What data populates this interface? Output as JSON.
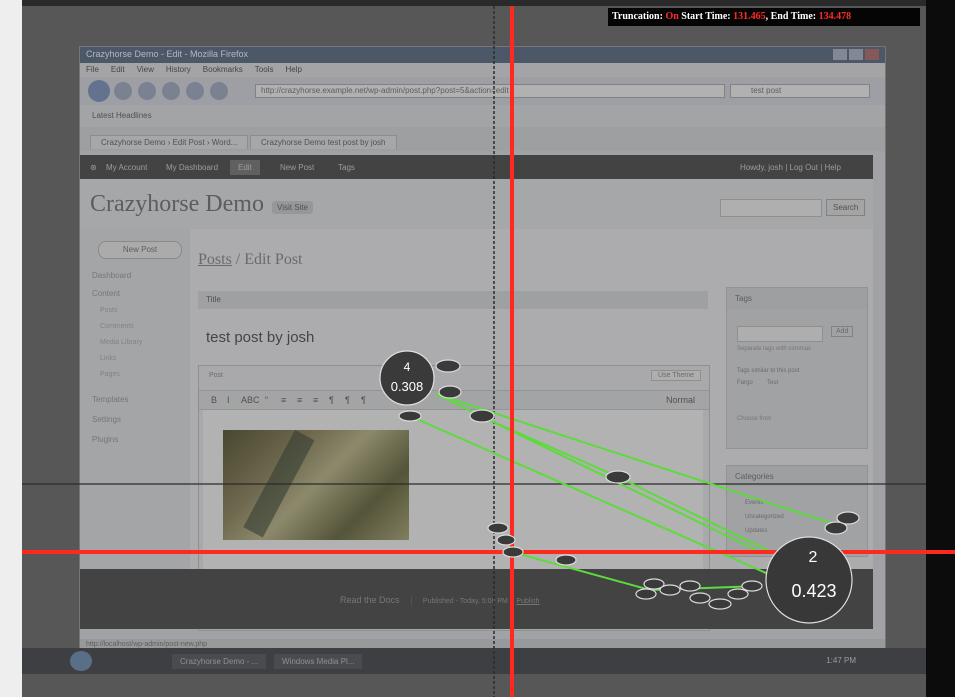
{
  "banner": {
    "truncation_label": "Truncation:",
    "truncation_value": "On",
    "start_label": "Start Time:",
    "start_value": "131.465",
    "end_label": "End Time:",
    "end_value": "134.478"
  },
  "browser": {
    "window_title": "Crazyhorse Demo - Edit - Mozilla Firefox",
    "menu": [
      "File",
      "Edit",
      "View",
      "History",
      "Bookmarks",
      "Tools",
      "Help"
    ],
    "url": "http://crazyhorse.example.net/wp-admin/post.php?post=5&action=edit",
    "search_value": "test post",
    "bookmarks_label": "Latest Headlines",
    "tabs": [
      "Crazyhorse Demo › Edit Post › Word...",
      "Crazyhorse Demo test post by josh"
    ],
    "status_url": "http://localhost/wp-admin/post-new.php"
  },
  "wp": {
    "admin_bar": [
      "My Account",
      "My Dashboard",
      "Edit",
      "New Post",
      "Tags"
    ],
    "admin_bar_right": "Howdy, josh  |  Log Out  |  Help",
    "site_title": "Crazyhorse Demo",
    "visit_site": "Visit Site",
    "search_button": "Search",
    "new_post_button": "New Post",
    "menu": [
      {
        "label": "Dashboard"
      },
      {
        "label": "Content"
      },
      {
        "label": "Posts",
        "sub": true
      },
      {
        "label": "Comments",
        "sub": true
      },
      {
        "label": "Media Library",
        "sub": true
      },
      {
        "label": "Links",
        "sub": true
      },
      {
        "label": "Pages",
        "sub": true
      },
      {
        "label": "Templates"
      },
      {
        "label": "Settings"
      },
      {
        "label": "Plugins"
      }
    ],
    "breadcrumb_link": "Posts",
    "breadcrumb_sep": " / ",
    "breadcrumb_page": "Edit Post",
    "title_label": "Title",
    "post_title": "test post by josh",
    "editor_label": "Post",
    "use_theme": "Use Theme",
    "format_label": "Normal",
    "toolbar_buttons": [
      "B",
      "I",
      "ABC",
      "“",
      "≡",
      "≡",
      "≡",
      "¶",
      "¶",
      "¶"
    ],
    "tags_title": "Tags",
    "add_button": "Add",
    "tags_hint": "Separate tags with commas",
    "tags_help": "Tags similar to this post",
    "tag_item_1": "Fargo",
    "tag_item_2": "Test",
    "tags_more": "Choose from",
    "categories_title": "Categories",
    "categories": [
      "Events",
      "Uncategorized",
      "Updates"
    ],
    "footer_link": "Read the Docs",
    "footer_text": "Published - Today, 5:00 PM",
    "footer_link2": "Publish"
  },
  "taskbar": {
    "items": [
      "Crazyhorse Demo - ...",
      "Windows Media Pl..."
    ],
    "clock": "1:47 PM"
  },
  "fixations": [
    {
      "id": "4",
      "value": "0.308"
    },
    {
      "id": "2",
      "value": "0.423"
    }
  ],
  "colors": {
    "crosshair": "#ff2a1f",
    "saccade": "#5ddb3c",
    "fixation": "#333333"
  }
}
